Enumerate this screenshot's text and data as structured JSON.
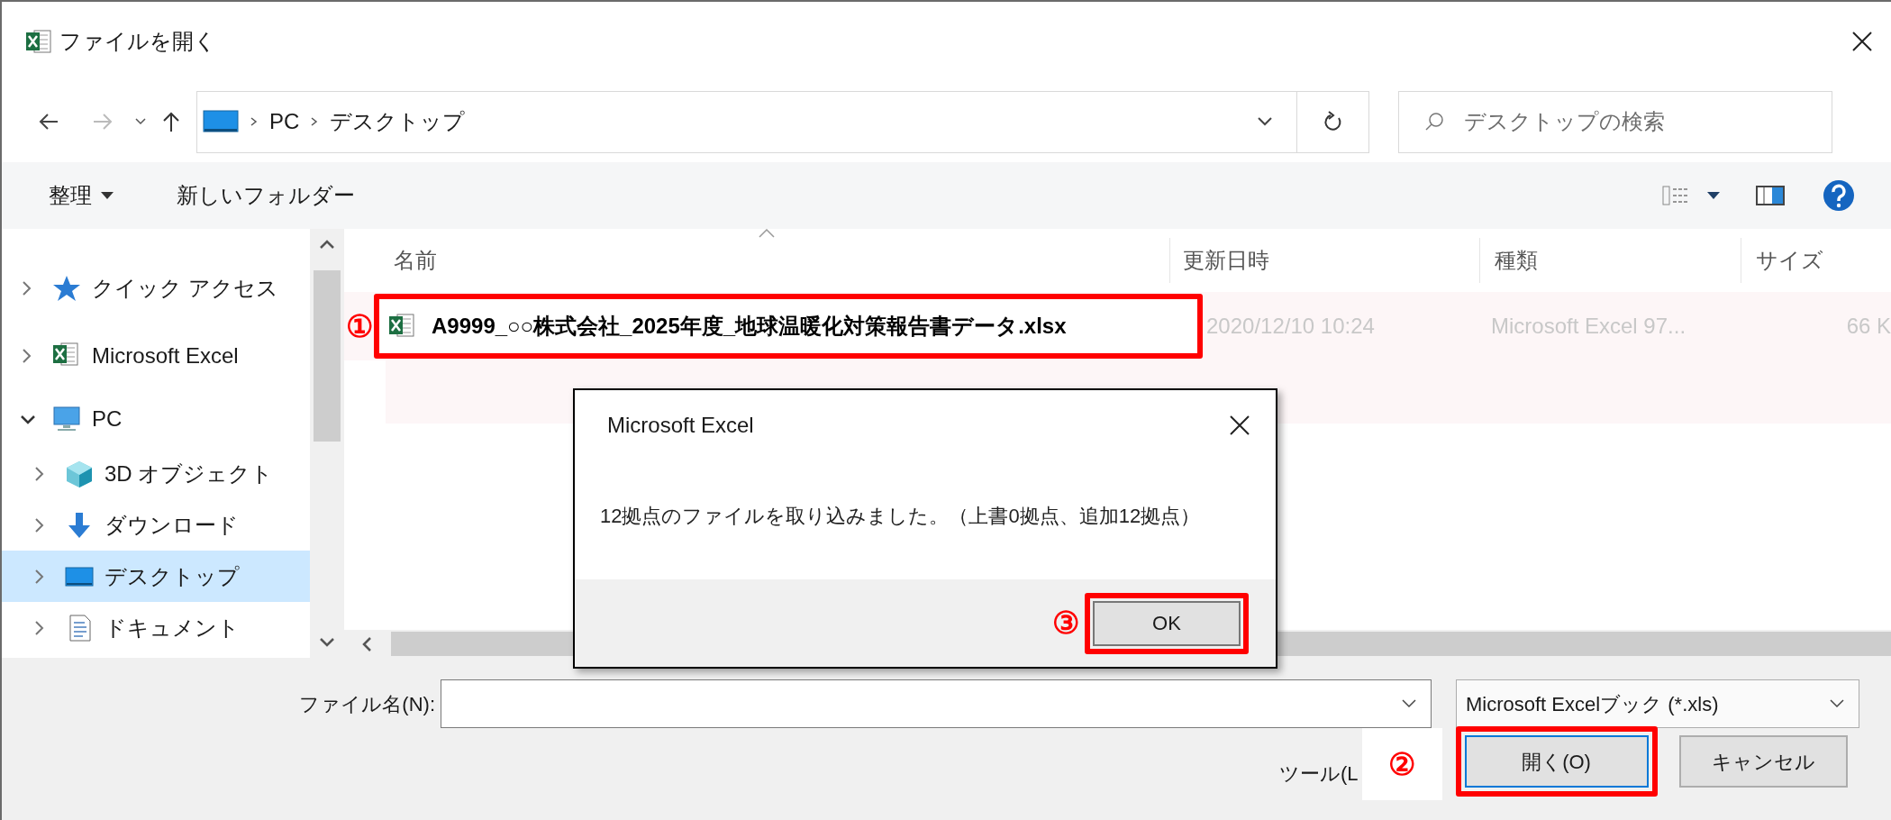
{
  "window": {
    "title": "ファイルを開く"
  },
  "nav": {
    "path": [
      "PC",
      "デスクトップ"
    ],
    "search_placeholder": "デスクトップの検索"
  },
  "toolbar": {
    "items": [
      "整理",
      "新しいフォルダー"
    ]
  },
  "sidebar": {
    "items": [
      {
        "label": "クイック アクセス",
        "kind": "star",
        "expanded": false,
        "selected": false
      },
      {
        "label": "Microsoft Excel",
        "kind": "excel",
        "expanded": false,
        "selected": false
      },
      {
        "label": "PC",
        "kind": "pc",
        "expanded": true,
        "selected": false,
        "children": [
          {
            "label": "3D オブジェクト",
            "kind": "cube",
            "expanded": false,
            "selected": false
          },
          {
            "label": "ダウンロード",
            "kind": "download",
            "expanded": false,
            "selected": false
          },
          {
            "label": "デスクトップ",
            "kind": "desktop",
            "expanded": false,
            "selected": true
          },
          {
            "label": "ドキュメント",
            "kind": "document",
            "expanded": false,
            "selected": false
          }
        ]
      }
    ]
  },
  "file_list": {
    "columns": [
      "名前",
      "更新日時",
      "種類",
      "サイズ"
    ],
    "rows": [
      {
        "name": "A9999_○○株式会社_2025年度_地球温暖化対策報告書データ.xlsx",
        "modified": "2020/12/10 10:24",
        "type": "Microsoft Excel 97...",
        "size": "66 K",
        "annotation": "①"
      }
    ]
  },
  "dialog": {
    "title": "Microsoft Excel",
    "message": "12拠点のファイルを取り込みました。（上書0拠点、追加12拠点）",
    "button": "OK",
    "annotation": "③"
  },
  "file_name": {
    "label": "ファイル名(N):"
  },
  "file_type": "Microsoft Excelブック (*.xls)",
  "tools_label": "ツール(L",
  "buttons": [
    {
      "label": "開く(O)",
      "default": true,
      "annotation": "②"
    },
    {
      "label": "キャンセル",
      "default": false
    }
  ]
}
